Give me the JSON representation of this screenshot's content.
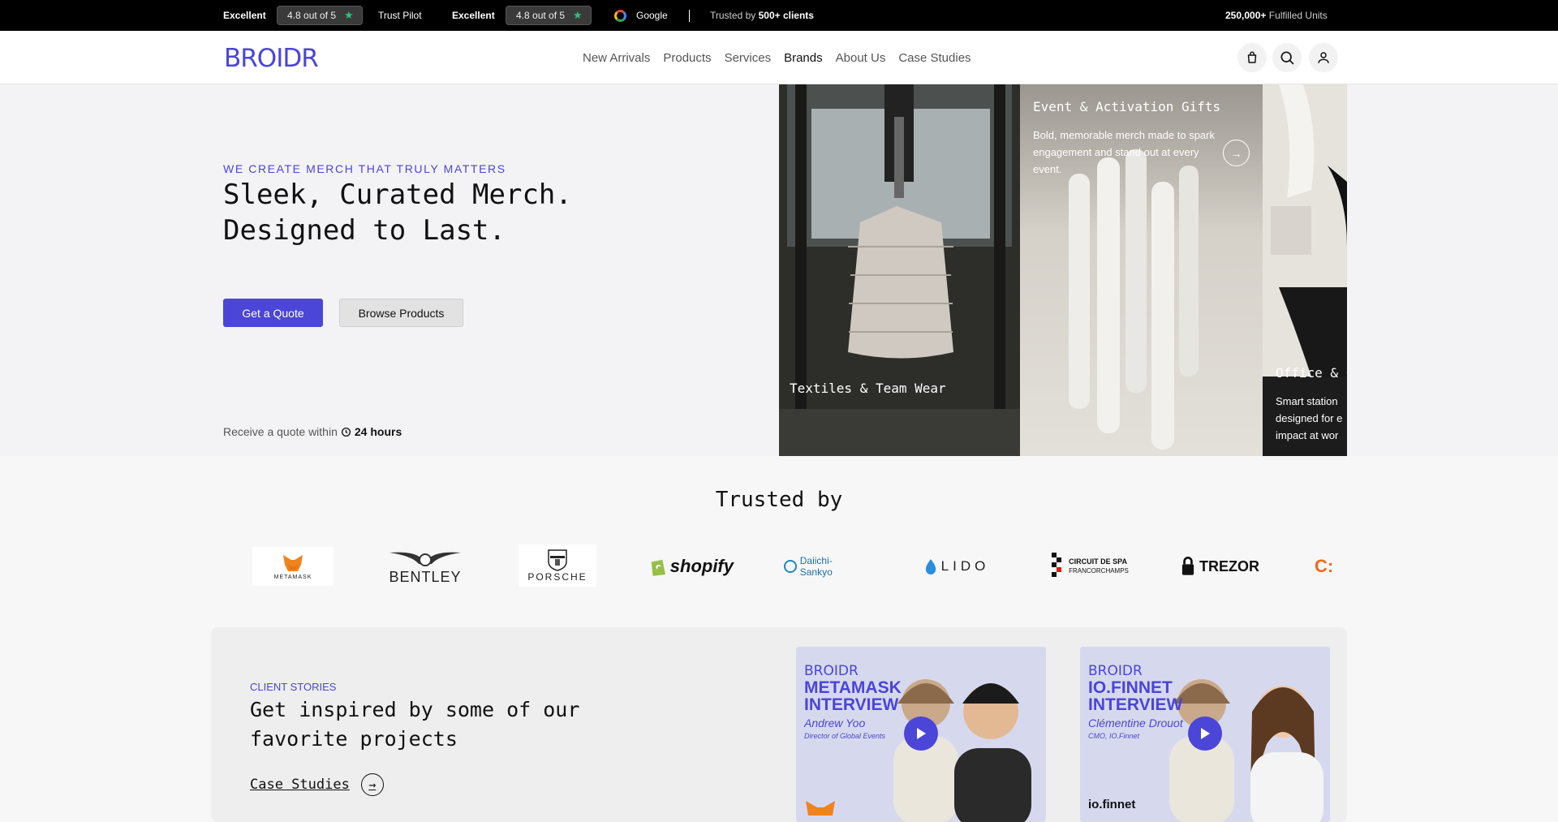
{
  "topbar": {
    "rating1_label": "Excellent",
    "rating1_value": "4.8 out of 5",
    "rating1_source": "Trust Pilot",
    "rating2_label": "Excellent",
    "rating2_value": "4.8 out of 5",
    "rating2_source": "Google",
    "trusted_prefix": "Trusted by",
    "trusted_count": "500+ clients",
    "fulfilled_count": "250,000+",
    "fulfilled_suffix": "Fulfilled Units"
  },
  "header": {
    "logo": "BROIDR",
    "nav": [
      "New Arrivals",
      "Products",
      "Services",
      "Brands",
      "About Us",
      "Case Studies"
    ],
    "active_nav": "Brands"
  },
  "hero": {
    "eyebrow": "WE CREATE MERCH THAT TRULY MATTERS",
    "title_line1": "Sleek, Curated Merch.",
    "title_line2": "Designed to Last.",
    "primary_button": "Get a Quote",
    "secondary_button": "Browse Products",
    "quote_prefix": "Receive a quote within",
    "quote_time": "24 hours"
  },
  "cards": [
    {
      "title": "Textiles & Team Wear",
      "desc": ""
    },
    {
      "title": "Event & Activation Gifts",
      "desc": "Bold, memorable merch made to spark engagement and stand out at every event."
    },
    {
      "title": "Office & C",
      "desc": "Smart station designed for e impact at wor"
    }
  ],
  "trusted": {
    "title": "Trusted by",
    "logos": [
      "METAMASK",
      "BENTLEY",
      "PORSCHE",
      "shopify",
      "Daiichi-Sankyo",
      "LIDO",
      "CIRCUIT DE SPA",
      "FRANCORCHAMPS",
      "TREZOR",
      "C:"
    ]
  },
  "stories": {
    "eyebrow": "CLIENT STORIES",
    "title_line1": "Get inspired by some of our",
    "title_line2": "favorite projects",
    "link": "Case Studies",
    "videos": [
      {
        "brand": "BROIDR",
        "title1": "METAMASK",
        "title2": "INTERVIEW",
        "name": "Andrew Yoo",
        "role": "Director of Global Events"
      },
      {
        "brand": "BROIDR",
        "title1": "IO.FINNET",
        "title2": "INTERVIEW",
        "name": "Clémentine Drouot",
        "role": "CMO, IO.Finnet",
        "footer": "io.finnet"
      }
    ]
  },
  "colors": {
    "accent": "#4b45d8",
    "rating_star": "#2ec27e",
    "topbar_bg": "#000000"
  }
}
